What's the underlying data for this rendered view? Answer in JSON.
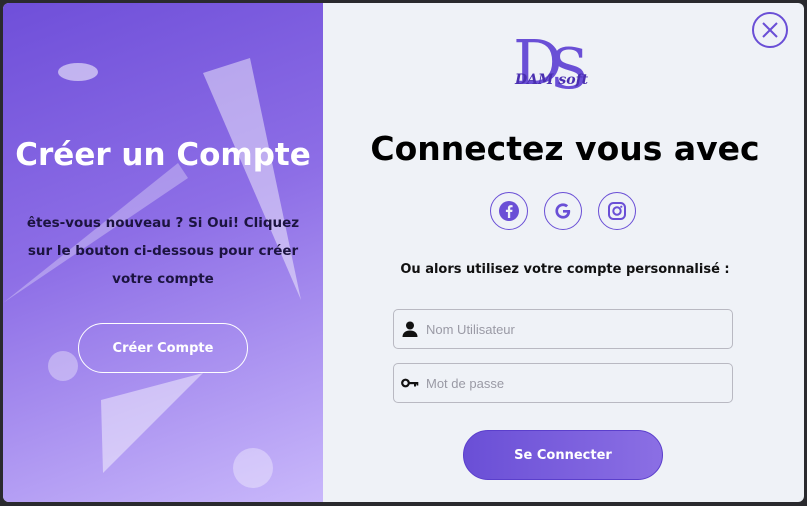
{
  "left_panel": {
    "title": "Créer un Compte",
    "description": "êtes-vous nouveau ? Si Oui! Cliquez sur le bouton ci-dessous pour créer votre compte",
    "create_button": "Créer Compte"
  },
  "right_panel": {
    "logo_text": "DAM soft",
    "title": "Connectez vous avec",
    "social_icons": [
      "facebook-icon",
      "google-icon",
      "instagram-icon"
    ],
    "subtitle": "Ou alors utilisez votre compte personnalisé :",
    "username_placeholder": "Nom Utilisateur",
    "password_placeholder": "Mot de passe",
    "login_button": "Se Connecter"
  },
  "colors": {
    "accent": "#6a4fd6",
    "panel_gradient_start": "#6f4fd9",
    "panel_gradient_end": "#c9b8fb",
    "background": "#eff2f7"
  }
}
